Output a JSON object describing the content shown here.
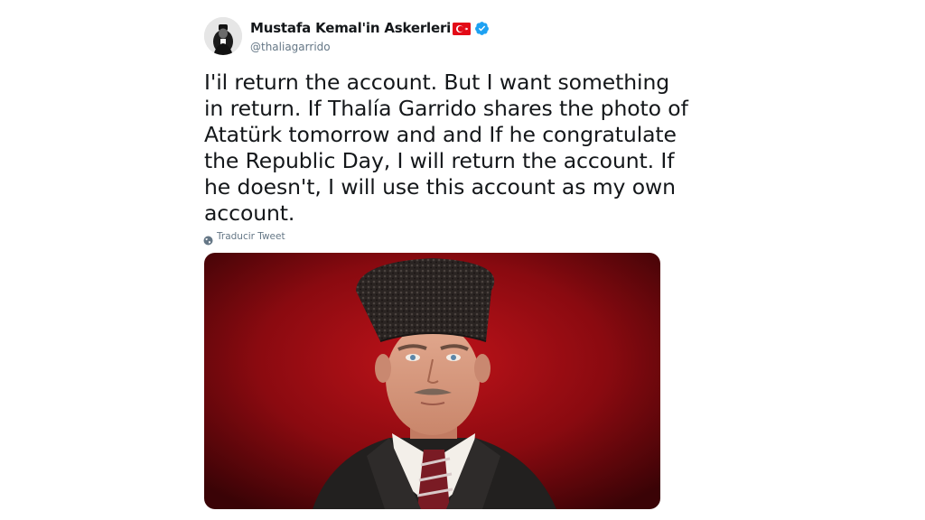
{
  "tweet": {
    "display_name": "Mustafa Kemal'in Askerleri",
    "handle": "@thaliagarrido",
    "flag_icon": "turkey-flag-icon",
    "verified_icon": "verified-badge-icon",
    "text": "I'il return the account. But I want something\nin return. If Thalía Garrido shares the photo of\nAtatürk tomorrow and and If he congratulate\nthe Republic Day, I will return the account. If\nhe doesn't, I will use this account as my own\naccount.",
    "translate_label": "Traducir Tweet",
    "translate_icon": "globe-icon",
    "media_icon": "portrait-photo"
  },
  "colors": {
    "verified_blue": "#1da1f2",
    "flag_red": "#e30a17",
    "secondary_text": "#657786",
    "primary_text": "#14171a"
  }
}
